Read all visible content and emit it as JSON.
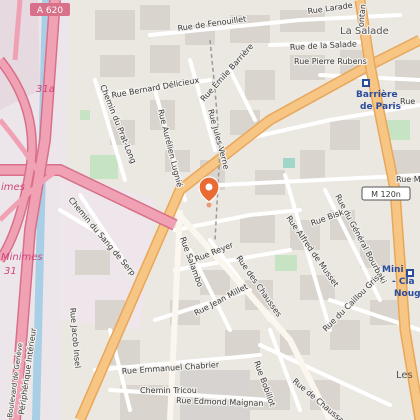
{
  "map": {
    "highways": {
      "a620": "A 620",
      "exit31a": "31a",
      "minimes_left": "imes",
      "minimes_lower": "Minimes",
      "exit31": "31",
      "peripherique": "Périphérique Intérieur",
      "boulevard_geneve": "Boulevard de Genève"
    },
    "route_shield": "M 120n",
    "metro": {
      "barriere_line1": "Barrière",
      "barriere_line2": "de Paris",
      "minimes_line1": "Mini",
      "minimes_line2": "- Cla",
      "minimes_line3": "Noug"
    },
    "places": {
      "la_salade": "La Salade",
      "les": "Les"
    },
    "streets": [
      "Rue Larade",
      "Rue de Fenouillet",
      "Rue de la Salade",
      "Rue Pierre Rubens",
      "Rue Bernard Délicieux",
      "Rue Émile Barrière",
      "Chemin du Prat-Long",
      "Rue Aurélien Lugnié",
      "Rue Jules Verne",
      "Rue Marc",
      "Chemin du Sang de Serp",
      "Rue du Général Bourbaki",
      "Rue Bisk",
      "Rue Alfred de Musset",
      "Rue Reyer",
      "Rue Salambo",
      "Rue des Chausses",
      "Rue Jean Millet",
      "Rue du Caillou Gris",
      "Rue Jacob Insel",
      "Rue Emmanuel Chabrier",
      "Chemin Tricou",
      "Rue Edmond Maignan",
      "Rue Bobillot",
      "Rue de Chaussas",
      "Rue",
      "ontan"
    ],
    "marker_icon": "location-pin-icon"
  }
}
